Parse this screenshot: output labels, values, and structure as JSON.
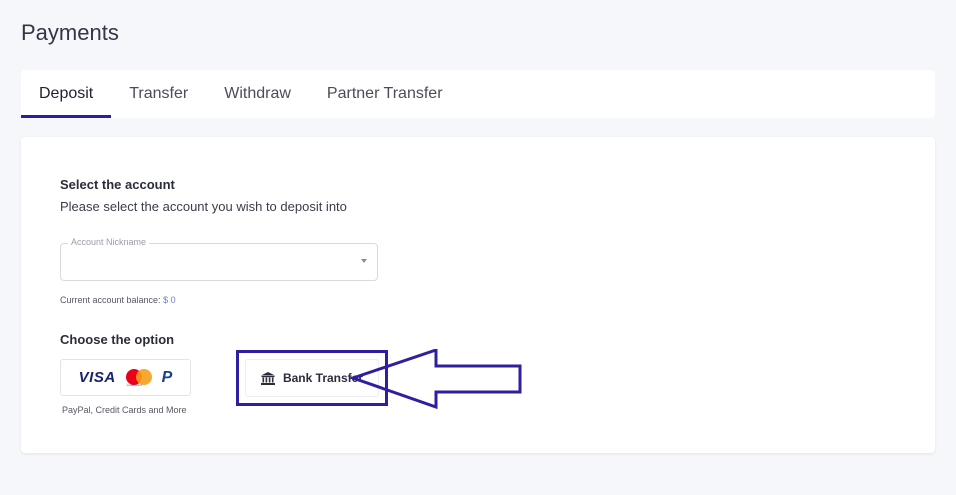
{
  "page_title": "Payments",
  "tabs": [
    {
      "label": "Deposit",
      "active": true
    },
    {
      "label": "Transfer",
      "active": false
    },
    {
      "label": "Withdraw",
      "active": false
    },
    {
      "label": "Partner Transfer",
      "active": false
    }
  ],
  "select_account": {
    "title": "Select the account",
    "description": "Please select the account you wish to deposit into",
    "field_label": "Account Nickname",
    "value": "",
    "balance_label": "Current account balance:",
    "balance_value": "$ 0"
  },
  "options": {
    "title": "Choose the option",
    "card_option": {
      "visa": "VISA",
      "mastercard_text": "mastercard",
      "paypal": "P",
      "caption": "PayPal, Credit Cards and More"
    },
    "bank_option": {
      "label": "Bank Transfer",
      "icon": "bank-icon"
    }
  },
  "colors": {
    "accent": "#2a1fa0",
    "highlight_border": "#2e1fa0",
    "balance_amount": "#6b7fc7"
  }
}
